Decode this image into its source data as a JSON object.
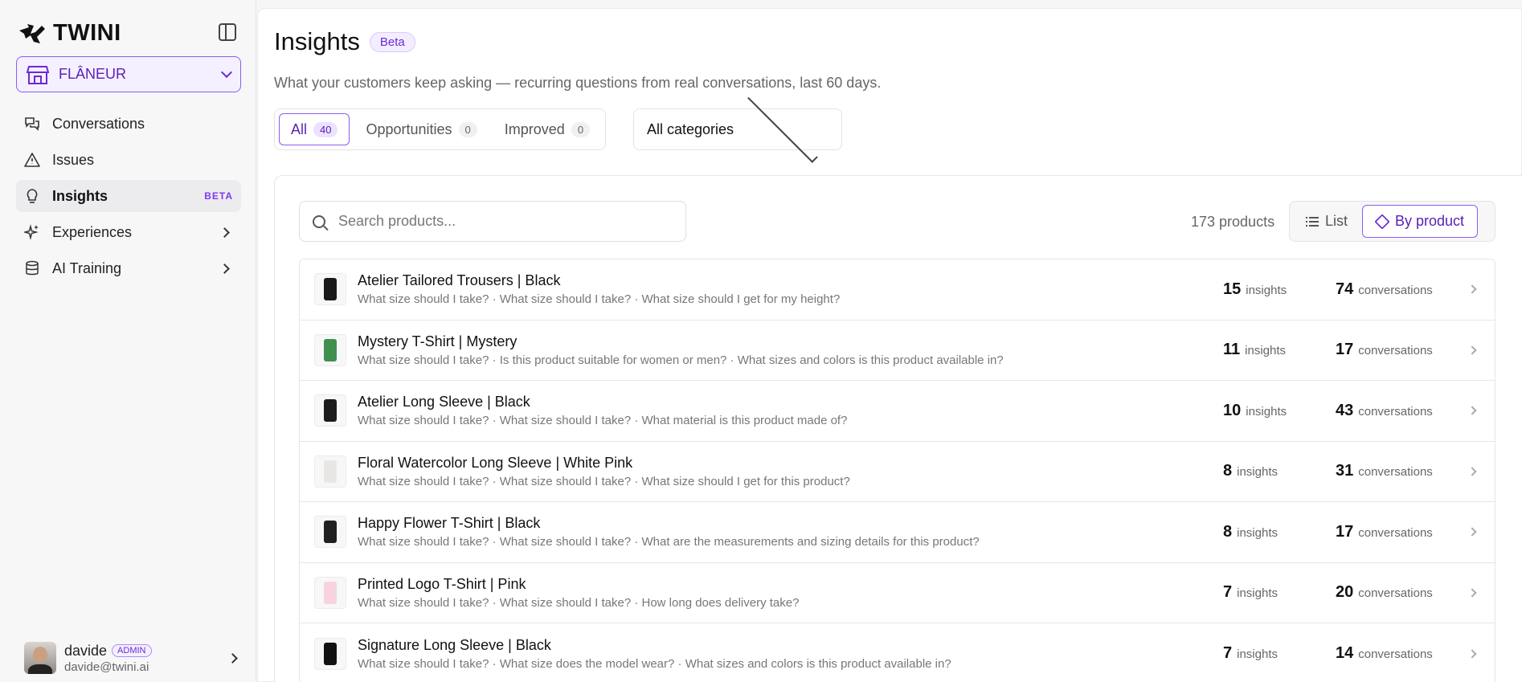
{
  "brand": {
    "name": "TWINI"
  },
  "store": {
    "name": "FLÂNEUR"
  },
  "nav": [
    {
      "label": "Conversations",
      "icon": "chat-icon"
    },
    {
      "label": "Issues",
      "icon": "warning-icon"
    },
    {
      "label": "Insights",
      "icon": "bulb-icon",
      "badge": "BETA",
      "active": true
    },
    {
      "label": "Experiences",
      "icon": "sparkles-icon"
    },
    {
      "label": "AI Training",
      "icon": "database-icon"
    }
  ],
  "user": {
    "name": "davide",
    "role": "ADMIN",
    "email": "davide@twini.ai"
  },
  "page": {
    "title": "Insights",
    "badge": "Beta",
    "subtitle": "What your customers keep asking — recurring questions from real conversations, last 60 days."
  },
  "tabs": [
    {
      "label": "All",
      "count": "40"
    },
    {
      "label": "Opportunities",
      "count": "0"
    },
    {
      "label": "Improved",
      "count": "0"
    }
  ],
  "category_filter": {
    "value": "All categories"
  },
  "search": {
    "placeholder": "Search products..."
  },
  "product_count": "173 products",
  "view": {
    "list_label": "List",
    "product_label": "By product"
  },
  "stat_labels": {
    "insights": "insights",
    "conversations": "conversations"
  },
  "products": [
    {
      "name": "Atelier Tailored Trousers | Black",
      "questions": "What size should I take? · What size should I take? · What size should I get for my height?",
      "insights": "15",
      "conversations": "74",
      "color": "#1a1a1a"
    },
    {
      "name": "Mystery T-Shirt | Mystery",
      "questions": "What size should I take? · Is this product suitable for women or men? · What sizes and colors is this product available in?",
      "insights": "11",
      "conversations": "17",
      "color": "#3f8f50"
    },
    {
      "name": "Atelier Long Sleeve | Black",
      "questions": "What size should I take? · What size should I take? · What material is this product made of?",
      "insights": "10",
      "conversations": "43",
      "color": "#1c1c1c"
    },
    {
      "name": "Floral Watercolor Long Sleeve | White Pink",
      "questions": "What size should I take? · What size should I take? · What size should I get for this product?",
      "insights": "8",
      "conversations": "31",
      "color": "#e9e6e6"
    },
    {
      "name": "Happy Flower T-Shirt | Black",
      "questions": "What size should I take? · What size should I take? · What are the measurements and sizing details for this product?",
      "insights": "8",
      "conversations": "17",
      "color": "#202020"
    },
    {
      "name": "Printed Logo T-Shirt | Pink",
      "questions": "What size should I take? · What size should I take? · How long does delivery take?",
      "insights": "7",
      "conversations": "20",
      "color": "#f6d3df"
    },
    {
      "name": "Signature Long Sleeve | Black",
      "questions": "What size should I take? · What size does the model wear? · What sizes and colors is this product available in?",
      "insights": "7",
      "conversations": "14",
      "color": "#111111"
    }
  ]
}
